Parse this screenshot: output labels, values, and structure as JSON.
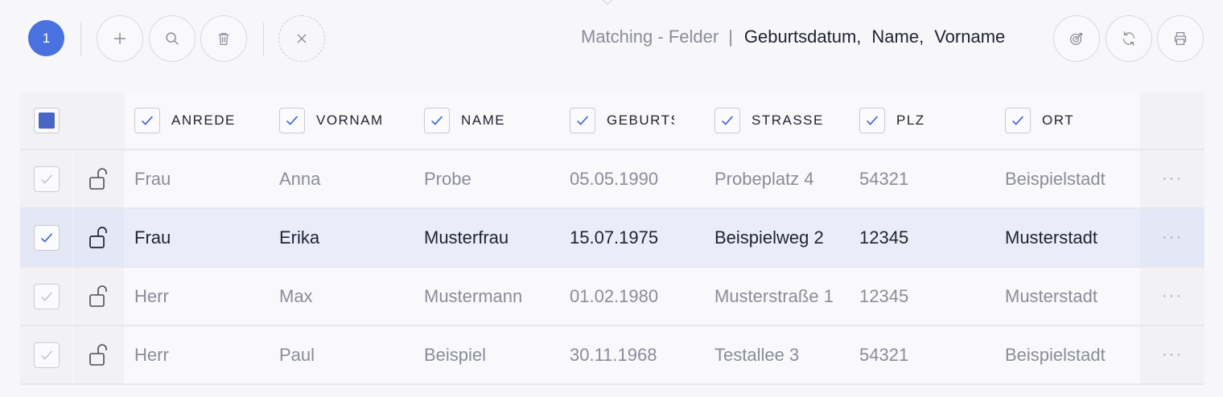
{
  "toolbar": {
    "badge_count": "1",
    "matching_label": "Matching - Felder",
    "matching_separator": "|",
    "matching_fields": [
      "Geburtsdatum,",
      "Name,",
      "Vorname"
    ],
    "buttons": {
      "add": "plus-icon",
      "search": "search-icon",
      "delete": "trash-icon",
      "cancel": "close-icon",
      "target": "target-icon",
      "refresh": "refresh-icon",
      "print": "print-icon"
    }
  },
  "table": {
    "columns": [
      "ANREDE",
      "VORNAM",
      "NAME",
      "GEBURTS",
      "STRASSE",
      "PLZ",
      "ORT"
    ],
    "rows": [
      {
        "anrede": "Frau",
        "vorname": "Anna",
        "name": "Probe",
        "geburtsdatum": "05.05.1990",
        "strasse": "Probeplatz 4",
        "plz": "54321",
        "ort": "Beispielstadt",
        "selected": false
      },
      {
        "anrede": "Frau",
        "vorname": "Erika",
        "name": "Musterfrau",
        "geburtsdatum": "15.07.1975",
        "strasse": "Beispielweg 2",
        "plz": "12345",
        "ort": "Musterstadt",
        "selected": true
      },
      {
        "anrede": "Herr",
        "vorname": "Max",
        "name": "Mustermann",
        "geburtsdatum": "01.02.1980",
        "strasse": "Musterstraße 1",
        "plz": "12345",
        "ort": "Musterstadt",
        "selected": false
      },
      {
        "anrede": "Herr",
        "vorname": "Paul",
        "name": "Beispiel",
        "geburtsdatum": "30.11.1968",
        "strasse": "Testallee 3",
        "plz": "54321",
        "ort": "Beispielstadt",
        "selected": false
      }
    ],
    "row_menu_label": "···"
  },
  "colors": {
    "accent": "#4a71e0",
    "check_selected": "#3f63d6",
    "check_muted": "#b9bbc5",
    "selected_row": "#eaedf9"
  }
}
